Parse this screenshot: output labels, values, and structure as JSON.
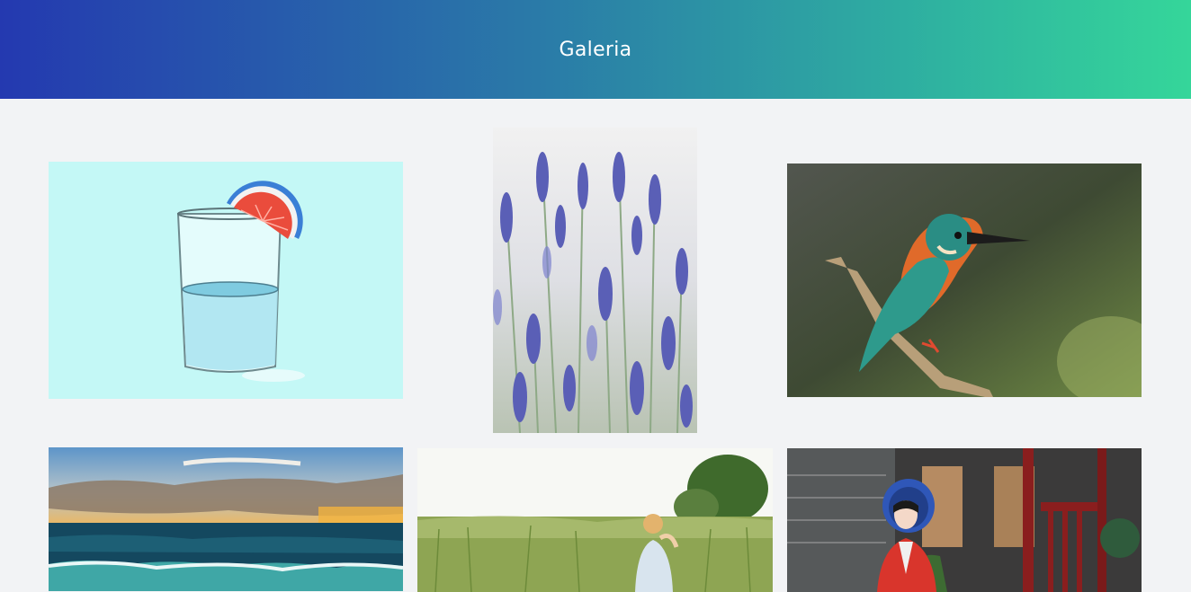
{
  "header": {
    "title": "Galeria"
  },
  "gallery": {
    "items": [
      {
        "subject": "glass-of-water-with-grapefruit-slice"
      },
      {
        "subject": "lavender-flowers"
      },
      {
        "subject": "kingfisher-on-branch"
      },
      {
        "subject": "ocean-at-sunset"
      },
      {
        "subject": "girl-in-meadow"
      },
      {
        "subject": "woman-in-traditional-dress"
      }
    ]
  },
  "colors": {
    "header_gradient_start": "#2439b0",
    "header_gradient_end": "#35d69a",
    "page_background": "#f2f3f5",
    "title_text": "#ffffff"
  }
}
